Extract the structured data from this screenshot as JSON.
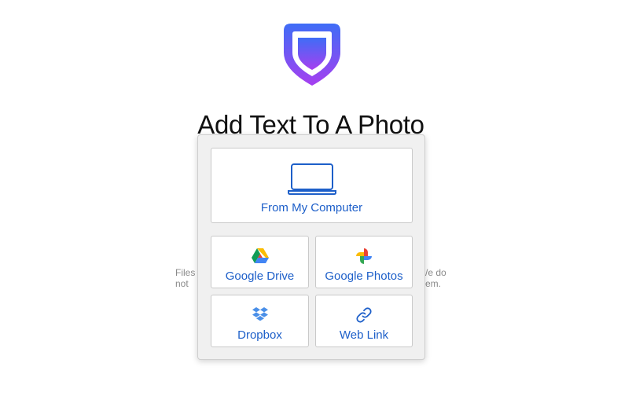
{
  "header": {
    "title": "Add Text To A Photo"
  },
  "background_notes": {
    "left": "Files\nnot",
    "right": "/e do\nem."
  },
  "picker": {
    "computer_label": "From My Computer",
    "google_drive_label": "Google Drive",
    "google_photos_label": "Google Photos",
    "dropbox_label": "Dropbox",
    "web_link_label": "Web Link"
  },
  "icons": {
    "logo": "shield-logo",
    "computer": "laptop-icon",
    "google_drive": "google-drive-icon",
    "google_photos": "google-photos-icon",
    "dropbox": "dropbox-icon",
    "web_link": "link-icon"
  },
  "colors": {
    "accent": "#1d5fc9",
    "logo_gradient_top": "#3f6df6",
    "logo_gradient_bottom": "#a63ff0"
  }
}
